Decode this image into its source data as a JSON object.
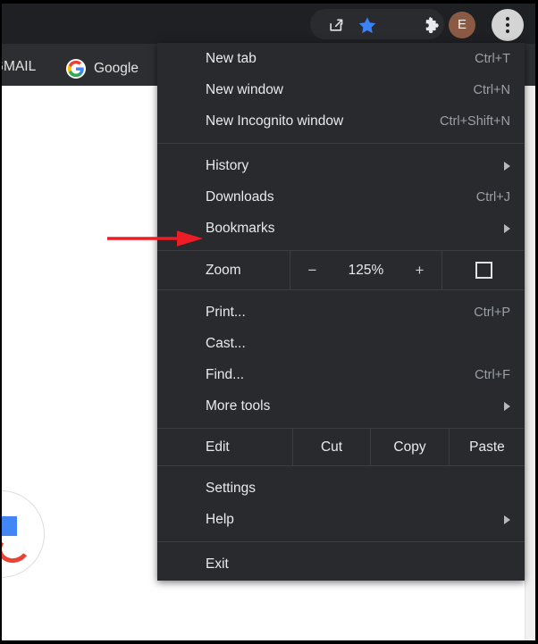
{
  "browser": {
    "toolbar": {
      "share_icon": "share-icon",
      "bookmark_star_icon": "star-icon",
      "extensions_icon": "puzzle-piece-icon",
      "avatar_initial": "E",
      "menu_icon": "three-dot-menu-icon"
    },
    "bookmarks_bar": {
      "items": [
        {
          "label": "GMAIL",
          "icon": ""
        },
        {
          "label": "Google",
          "icon": "google-g-icon"
        }
      ]
    }
  },
  "menu": {
    "groups": [
      {
        "items": [
          {
            "label": "New tab",
            "accel": "Ctrl+T",
            "submenu": false
          },
          {
            "label": "New window",
            "accel": "Ctrl+N",
            "submenu": false
          },
          {
            "label": "New Incognito window",
            "accel": "Ctrl+Shift+N",
            "submenu": false
          }
        ]
      },
      {
        "items": [
          {
            "label": "History",
            "accel": "",
            "submenu": true
          },
          {
            "label": "Downloads",
            "accel": "Ctrl+J",
            "submenu": false
          },
          {
            "label": "Bookmarks",
            "accel": "",
            "submenu": true
          }
        ]
      }
    ],
    "zoom": {
      "label": "Zoom",
      "minus_label": "−",
      "value": "125%",
      "plus_label": "+",
      "fullscreen_icon": "fullscreen-icon"
    },
    "tools_group": {
      "items": [
        {
          "label": "Print...",
          "accel": "Ctrl+P",
          "submenu": false
        },
        {
          "label": "Cast...",
          "accel": "",
          "submenu": false
        },
        {
          "label": "Find...",
          "accel": "Ctrl+F",
          "submenu": false
        },
        {
          "label": "More tools",
          "accel": "",
          "submenu": true
        }
      ]
    },
    "edit_row": {
      "label": "Edit",
      "cut": "Cut",
      "copy": "Copy",
      "paste": "Paste"
    },
    "settings_group": {
      "items": [
        {
          "label": "Settings",
          "accel": "",
          "submenu": false
        },
        {
          "label": "Help",
          "accel": "",
          "submenu": true
        }
      ]
    },
    "exit_group": {
      "items": [
        {
          "label": "Exit",
          "accel": "",
          "submenu": false
        }
      ]
    }
  },
  "annotation": {
    "arrow_color": "#ee1c25",
    "points_to": "Bookmarks"
  },
  "colors": {
    "menu_background": "#292a2d",
    "toolbar_background": "#1e2023",
    "bookmarks_bar_background": "#2c2e31",
    "accent_star": "#3b82f6",
    "avatar": "#8b5a44",
    "menu_button_highlight": "#d4d4d4"
  }
}
